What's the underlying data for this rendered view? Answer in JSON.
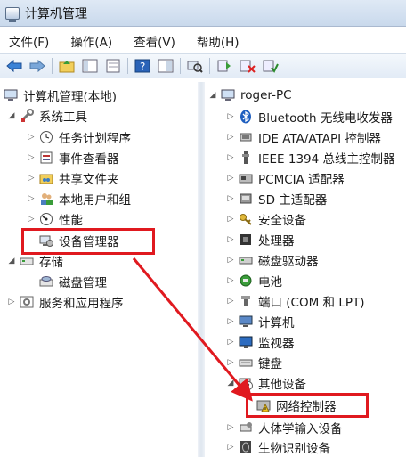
{
  "window": {
    "title": "计算机管理"
  },
  "menu": [
    "文件(F)",
    "操作(A)",
    "查看(V)",
    "帮助(H)"
  ],
  "left_tree": {
    "root": "计算机管理(本地)",
    "system_tools": "系统工具",
    "task_scheduler": "任务计划程序",
    "event_viewer": "事件查看器",
    "shared_folders": "共享文件夹",
    "local_users": "本地用户和组",
    "performance": "性能",
    "device_manager": "设备管理器",
    "storage": "存储",
    "disk_management": "磁盘管理",
    "services_apps": "服务和应用程序"
  },
  "right_tree": {
    "root": "roger-PC",
    "items": [
      "Bluetooth 无线电收发器",
      "IDE ATA/ATAPI 控制器",
      "IEEE 1394 总线主控制器",
      "PCMCIA 适配器",
      "SD 主适配器",
      "安全设备",
      "处理器",
      "磁盘驱动器",
      "电池",
      "端口 (COM 和 LPT)",
      "计算机",
      "监视器",
      "键盘",
      "其他设备"
    ],
    "network_controller": "网络控制器",
    "hid": "人体学输入设备",
    "biometric": "生物识别设备"
  },
  "colors": {
    "highlight": "#e0191f",
    "accent": "#2a63b8"
  }
}
